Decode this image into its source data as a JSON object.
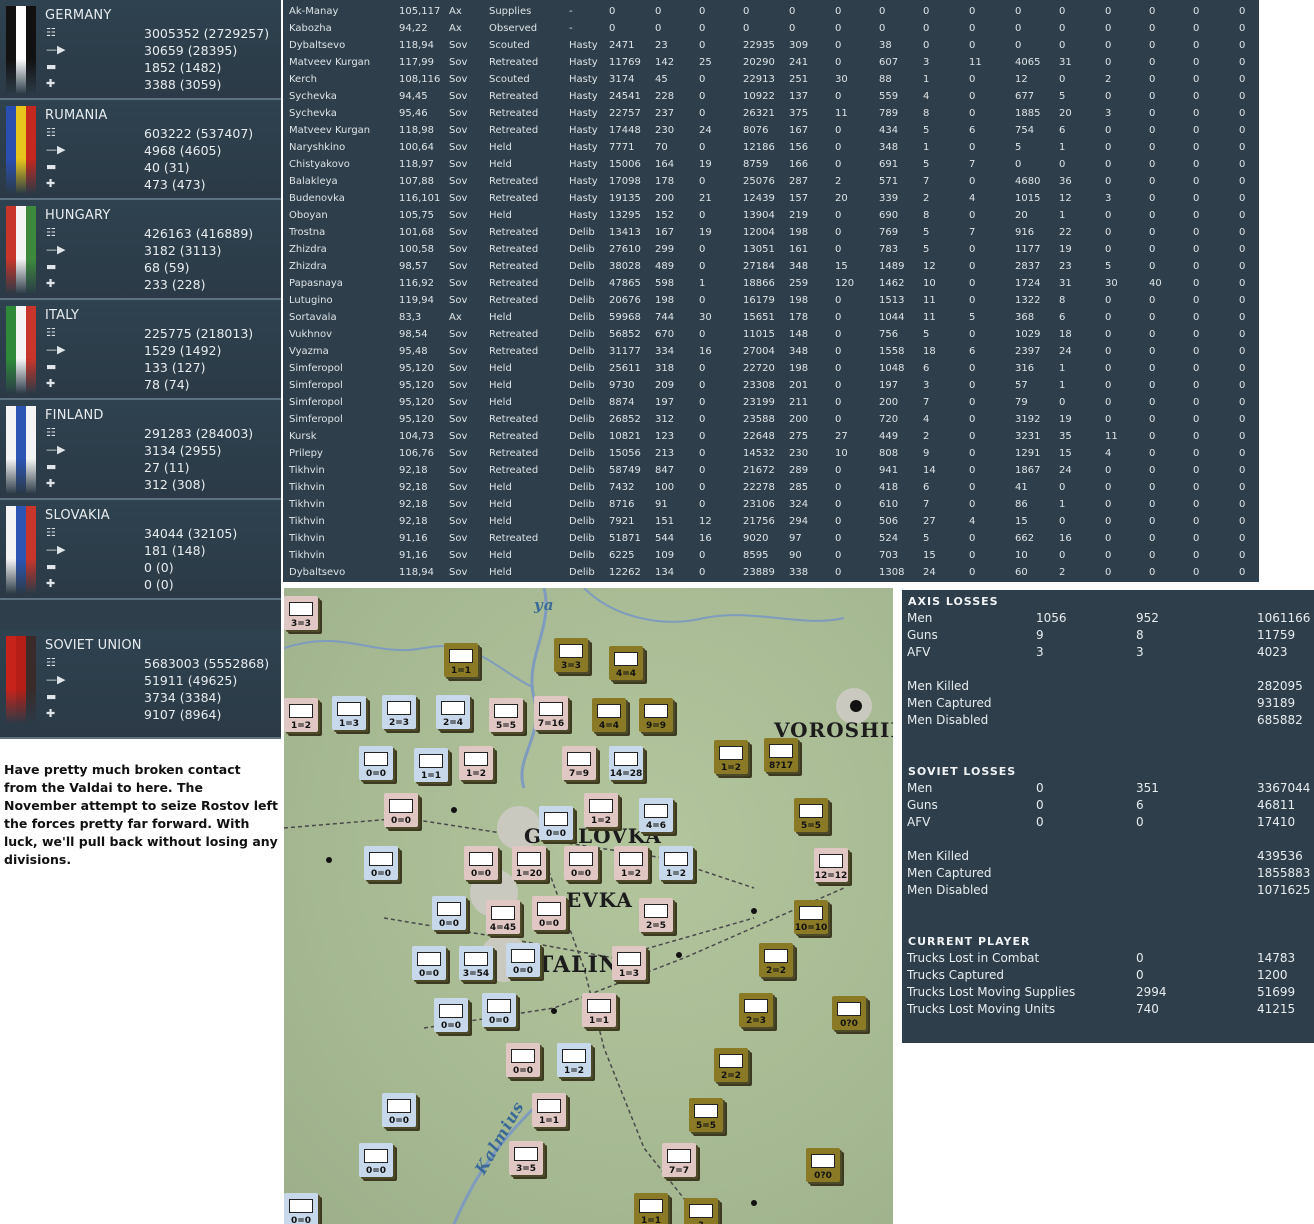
{
  "nations": [
    {
      "name": "GERMANY",
      "stats": [
        "3005352 (2729257)",
        "30659 (28395)",
        "1852 (1482)",
        "3388 (3059)"
      ],
      "colors": [
        "#111111",
        "#ffffff",
        "#111111"
      ]
    },
    {
      "name": "RUMANIA",
      "stats": [
        "603222 (537407)",
        "4968 (4605)",
        "40 (31)",
        "473 (473)"
      ],
      "colors": [
        "#2b4fb0",
        "#e8c51c",
        "#c4281f"
      ]
    },
    {
      "name": "HUNGARY",
      "stats": [
        "426163 (416889)",
        "3182 (3113)",
        "68 (59)",
        "233 (228)"
      ],
      "colors": [
        "#c8352b",
        "#f4f4f4",
        "#3d8a3d"
      ]
    },
    {
      "name": "ITALY",
      "stats": [
        "225775 (218013)",
        "1529 (1492)",
        "133 (127)",
        "78 (74)"
      ],
      "colors": [
        "#2f8a3a",
        "#f4f4f4",
        "#c8352b"
      ]
    },
    {
      "name": "FINLAND",
      "stats": [
        "291283 (284003)",
        "3134 (2955)",
        "27 (11)",
        "312 (308)"
      ],
      "colors": [
        "#f4f4f4",
        "#2d55b4",
        "#f4f4f4"
      ]
    },
    {
      "name": "SLOVAKIA",
      "stats": [
        "34044 (32105)",
        "181 (148)",
        "0 (0)",
        "0 (0)"
      ],
      "colors": [
        "#f4f4f4",
        "#2d55b4",
        "#c8352b"
      ]
    },
    {
      "name": "SOVIET UNION",
      "stats": [
        "5683003 (5552868)",
        "51911 (49625)",
        "3734 (3384)",
        "9107 (8964)"
      ],
      "colors": [
        "#c8231a",
        "#b51e16",
        "#3a2a2a"
      ]
    }
  ],
  "icons": [
    "men-icon",
    "gun-icon",
    "tank-icon",
    "plane-icon"
  ],
  "battles": [
    [
      "Ak-Manay",
      "105,117",
      "Ax",
      "Supplies",
      "-",
      "0",
      "0",
      "0",
      "0",
      "0",
      "0",
      "0",
      "0",
      "0",
      "0",
      "0",
      "0",
      "0",
      "0",
      "0"
    ],
    [
      "Kabozha",
      "94,22",
      "Ax",
      "Observed",
      "-",
      "0",
      "0",
      "0",
      "0",
      "0",
      "0",
      "0",
      "0",
      "0",
      "0",
      "0",
      "0",
      "0",
      "0",
      "0"
    ],
    [
      "Dybaltsevo",
      "118,94",
      "Sov",
      "Scouted",
      "Hasty",
      "2471",
      "23",
      "0",
      "22935",
      "309",
      "0",
      "38",
      "0",
      "0",
      "0",
      "0",
      "0",
      "0",
      "0",
      "0"
    ],
    [
      "Matveev Kurgan",
      "117,99",
      "Sov",
      "Retreated",
      "Hasty",
      "11769",
      "142",
      "25",
      "20290",
      "241",
      "0",
      "607",
      "3",
      "11",
      "4065",
      "31",
      "0",
      "0",
      "0",
      "0"
    ],
    [
      "Kerch",
      "108,116",
      "Sov",
      "Scouted",
      "Hasty",
      "3174",
      "45",
      "0",
      "22913",
      "251",
      "30",
      "88",
      "1",
      "0",
      "12",
      "0",
      "2",
      "0",
      "0",
      "0"
    ],
    [
      "Sychevka",
      "94,45",
      "Sov",
      "Retreated",
      "Hasty",
      "24541",
      "228",
      "0",
      "10922",
      "137",
      "0",
      "559",
      "4",
      "0",
      "677",
      "5",
      "0",
      "0",
      "0",
      "0"
    ],
    [
      "Sychevka",
      "95,46",
      "Sov",
      "Retreated",
      "Hasty",
      "22757",
      "237",
      "0",
      "26321",
      "375",
      "11",
      "789",
      "8",
      "0",
      "1885",
      "20",
      "3",
      "0",
      "0",
      "0"
    ],
    [
      "Matveev Kurgan",
      "118,98",
      "Sov",
      "Retreated",
      "Hasty",
      "17448",
      "230",
      "24",
      "8076",
      "167",
      "0",
      "434",
      "5",
      "6",
      "754",
      "6",
      "0",
      "0",
      "0",
      "0"
    ],
    [
      "Naryshkino",
      "100,64",
      "Sov",
      "Held",
      "Hasty",
      "7771",
      "70",
      "0",
      "12186",
      "156",
      "0",
      "348",
      "1",
      "0",
      "5",
      "1",
      "0",
      "0",
      "0",
      "0"
    ],
    [
      "Chistyakovo",
      "118,97",
      "Sov",
      "Held",
      "Hasty",
      "15006",
      "164",
      "19",
      "8759",
      "166",
      "0",
      "691",
      "5",
      "7",
      "0",
      "0",
      "0",
      "0",
      "0",
      "0"
    ],
    [
      "Balakleya",
      "107,88",
      "Sov",
      "Retreated",
      "Hasty",
      "17098",
      "178",
      "0",
      "25076",
      "287",
      "2",
      "571",
      "7",
      "0",
      "4680",
      "36",
      "0",
      "0",
      "0",
      "0"
    ],
    [
      "Budenovka",
      "116,101",
      "Sov",
      "Retreated",
      "Hasty",
      "19135",
      "200",
      "21",
      "12439",
      "157",
      "20",
      "339",
      "2",
      "4",
      "1015",
      "12",
      "3",
      "0",
      "0",
      "0"
    ],
    [
      "Oboyan",
      "105,75",
      "Sov",
      "Held",
      "Hasty",
      "13295",
      "152",
      "0",
      "13904",
      "219",
      "0",
      "690",
      "8",
      "0",
      "20",
      "1",
      "0",
      "0",
      "0",
      "0"
    ],
    [
      "Trostna",
      "101,68",
      "Sov",
      "Retreated",
      "Delib",
      "13413",
      "167",
      "19",
      "12004",
      "198",
      "0",
      "769",
      "5",
      "7",
      "916",
      "22",
      "0",
      "0",
      "0",
      "0"
    ],
    [
      "Zhizdra",
      "100,58",
      "Sov",
      "Retreated",
      "Delib",
      "27610",
      "299",
      "0",
      "13051",
      "161",
      "0",
      "783",
      "5",
      "0",
      "1177",
      "19",
      "0",
      "0",
      "0",
      "0"
    ],
    [
      "Zhizdra",
      "98,57",
      "Sov",
      "Retreated",
      "Delib",
      "38028",
      "489",
      "0",
      "27184",
      "348",
      "15",
      "1489",
      "12",
      "0",
      "2837",
      "23",
      "5",
      "0",
      "0",
      "0"
    ],
    [
      "Papasnaya",
      "116,92",
      "Sov",
      "Retreated",
      "Delib",
      "47865",
      "598",
      "1",
      "18866",
      "259",
      "120",
      "1462",
      "10",
      "0",
      "1724",
      "31",
      "30",
      "40",
      "0",
      "0"
    ],
    [
      "Lutugino",
      "119,94",
      "Sov",
      "Retreated",
      "Delib",
      "20676",
      "198",
      "0",
      "16179",
      "198",
      "0",
      "1513",
      "11",
      "0",
      "1322",
      "8",
      "0",
      "0",
      "0",
      "0"
    ],
    [
      "Sortavala",
      "83,3",
      "Ax",
      "Held",
      "Delib",
      "59968",
      "744",
      "30",
      "15651",
      "178",
      "0",
      "1044",
      "11",
      "5",
      "368",
      "6",
      "0",
      "0",
      "0",
      "0"
    ],
    [
      "Vukhnov",
      "98,54",
      "Sov",
      "Retreated",
      "Delib",
      "56852",
      "670",
      "0",
      "11015",
      "148",
      "0",
      "756",
      "5",
      "0",
      "1029",
      "18",
      "0",
      "0",
      "0",
      "0"
    ],
    [
      "Vyazma",
      "95,48",
      "Sov",
      "Retreated",
      "Delib",
      "31177",
      "334",
      "16",
      "27004",
      "348",
      "0",
      "1558",
      "18",
      "6",
      "2397",
      "24",
      "0",
      "0",
      "0",
      "0"
    ],
    [
      "Simferopol",
      "95,120",
      "Sov",
      "Held",
      "Delib",
      "25611",
      "318",
      "0",
      "22720",
      "198",
      "0",
      "1048",
      "6",
      "0",
      "316",
      "1",
      "0",
      "0",
      "0",
      "0"
    ],
    [
      "Simferopol",
      "95,120",
      "Sov",
      "Held",
      "Delib",
      "9730",
      "209",
      "0",
      "23308",
      "201",
      "0",
      "197",
      "3",
      "0",
      "57",
      "1",
      "0",
      "0",
      "0",
      "0"
    ],
    [
      "Simferopol",
      "95,120",
      "Sov",
      "Held",
      "Delib",
      "8874",
      "197",
      "0",
      "23199",
      "211",
      "0",
      "200",
      "7",
      "0",
      "79",
      "0",
      "0",
      "0",
      "0",
      "0"
    ],
    [
      "Simferopol",
      "95,120",
      "Sov",
      "Retreated",
      "Delib",
      "26852",
      "312",
      "0",
      "23588",
      "200",
      "0",
      "720",
      "4",
      "0",
      "3192",
      "19",
      "0",
      "0",
      "0",
      "0"
    ],
    [
      "Kursk",
      "104,73",
      "Sov",
      "Retreated",
      "Delib",
      "10821",
      "123",
      "0",
      "22648",
      "275",
      "27",
      "449",
      "2",
      "0",
      "3231",
      "35",
      "11",
      "0",
      "0",
      "0"
    ],
    [
      "Prilepy",
      "106,76",
      "Sov",
      "Retreated",
      "Delib",
      "15056",
      "213",
      "0",
      "14532",
      "230",
      "10",
      "808",
      "9",
      "0",
      "1291",
      "15",
      "4",
      "0",
      "0",
      "0"
    ],
    [
      "Tikhvin",
      "92,18",
      "Sov",
      "Retreated",
      "Delib",
      "58749",
      "847",
      "0",
      "21672",
      "289",
      "0",
      "941",
      "14",
      "0",
      "1867",
      "24",
      "0",
      "0",
      "0",
      "0"
    ],
    [
      "Tikhvin",
      "92,18",
      "Sov",
      "Held",
      "Delib",
      "7432",
      "100",
      "0",
      "22278",
      "285",
      "0",
      "418",
      "6",
      "0",
      "41",
      "0",
      "0",
      "0",
      "0",
      "0"
    ],
    [
      "Tikhvin",
      "92,18",
      "Sov",
      "Held",
      "Delib",
      "8716",
      "91",
      "0",
      "23106",
      "324",
      "0",
      "610",
      "7",
      "0",
      "86",
      "1",
      "0",
      "0",
      "0",
      "0"
    ],
    [
      "Tikhvin",
      "92,18",
      "Sov",
      "Held",
      "Delib",
      "7921",
      "151",
      "12",
      "21756",
      "294",
      "0",
      "506",
      "27",
      "4",
      "15",
      "0",
      "0",
      "0",
      "0",
      "0"
    ],
    [
      "Tikhvin",
      "91,16",
      "Sov",
      "Retreated",
      "Delib",
      "51871",
      "544",
      "16",
      "9020",
      "97",
      "0",
      "524",
      "5",
      "0",
      "662",
      "16",
      "0",
      "0",
      "0",
      "0"
    ],
    [
      "Tikhvin",
      "91,16",
      "Sov",
      "Held",
      "Delib",
      "6225",
      "109",
      "0",
      "8595",
      "90",
      "0",
      "703",
      "15",
      "0",
      "10",
      "0",
      "0",
      "0",
      "0",
      "0"
    ],
    [
      "Dybaltsevo",
      "118,94",
      "Sov",
      "Held",
      "Delib",
      "12262",
      "134",
      "0",
      "23889",
      "338",
      "0",
      "1308",
      "24",
      "0",
      "60",
      "2",
      "0",
      "0",
      "0",
      "0"
    ]
  ],
  "map": {
    "places": [
      "VOROSHILO",
      "GORLOVKA",
      "EVKA",
      "STALIN",
      "Kalmius",
      "ya"
    ],
    "counters": [
      "3=3",
      "1=1",
      "3=3",
      "4=4",
      "1=2",
      "1=3",
      "2=3",
      "2=4",
      "5=5",
      "7=16",
      "4=4",
      "9=9",
      "0=0",
      "1=1",
      "1=2",
      "7=9",
      "14=28",
      "1=2",
      "8?17",
      "0=0",
      "0=0",
      "1=2",
      "4=6",
      "5=5",
      "0=0",
      "0=0",
      "1=20",
      "0=0",
      "1=2",
      "1=2",
      "12=12",
      "0=0",
      "4=45",
      "0=0",
      "2=5",
      "10=10",
      "0=0",
      "3=54",
      "0=0",
      "1=3",
      "2=2",
      "0=0",
      "0=0",
      "1=1",
      "2=3",
      "0?0",
      "0=0",
      "1=2",
      "2=2",
      "0=0",
      "1=1",
      "5=5",
      "0=0",
      "3=5",
      "7=7",
      "0?0",
      "0=0",
      "1=1",
      "?"
    ]
  },
  "losses": {
    "axis_title": "AXIS LOSSES",
    "axis": [
      [
        "Men",
        "1056",
        "952",
        "1061166"
      ],
      [
        "Guns",
        "9",
        "8",
        "11759"
      ],
      [
        "AFV",
        "3",
        "3",
        "4023"
      ]
    ],
    "axis_extra": [
      [
        "Men Killed",
        "282095"
      ],
      [
        "Men Captured",
        "93189"
      ],
      [
        "Men Disabled",
        "685882"
      ]
    ],
    "soviet_title": "SOVIET LOSSES",
    "soviet": [
      [
        "Men",
        "0",
        "351",
        "3367044"
      ],
      [
        "Guns",
        "0",
        "6",
        "46811"
      ],
      [
        "AFV",
        "0",
        "0",
        "17410"
      ]
    ],
    "soviet_extra": [
      [
        "Men Killed",
        "439536"
      ],
      [
        "Men Captured",
        "1855883"
      ],
      [
        "Men Disabled",
        "1071625"
      ]
    ],
    "player_title": "CURRENT PLAYER",
    "player": [
      [
        "Trucks Lost in Combat",
        "0",
        "14783"
      ],
      [
        "Trucks Captured",
        "0",
        "1200"
      ],
      [
        "Trucks Lost Moving Supplies",
        "2994",
        "51699"
      ],
      [
        "Trucks Lost Moving Units",
        "740",
        "41215"
      ]
    ]
  },
  "comment": "Have pretty much broken contact from the Valdai to here. The November attempt to seize Rostov left the forces pretty far forward. With luck, we'll pull back without losing any divisions."
}
